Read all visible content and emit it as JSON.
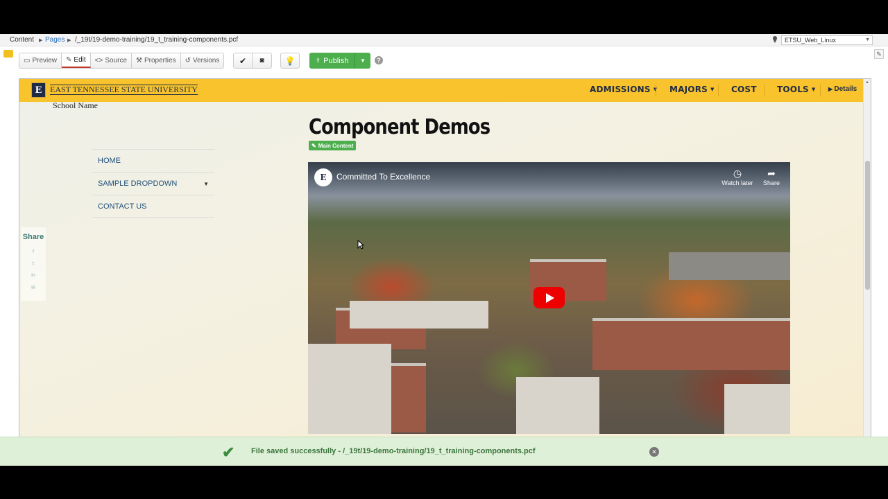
{
  "breadcrumb": {
    "root": "Content",
    "pages": "Pages",
    "path": "/_19t/19-demo-training/19_t_training-components.pcf"
  },
  "server": {
    "selected": "ETSU_Web_Linux"
  },
  "toolbar": {
    "preview": "Preview",
    "edit": "Edit",
    "source": "Source",
    "properties": "Properties",
    "versions": "Versions",
    "publish": "Publish",
    "help": "?"
  },
  "site": {
    "university": "EAST TENNESSEE STATE UNIVERSITY",
    "logo_letter": "E",
    "school_name": "School Name",
    "nav": [
      {
        "label": "ADMISSIONS",
        "dropdown": true
      },
      {
        "label": "MAJORS",
        "dropdown": true
      },
      {
        "label": "COST",
        "dropdown": false
      },
      {
        "label": "TOOLS",
        "dropdown": true
      }
    ],
    "details": "Details",
    "side_nav": [
      {
        "label": "HOME"
      },
      {
        "label": "SAMPLE DROPDOWN"
      },
      {
        "label": "CONTACT US"
      }
    ],
    "share_label": "Share",
    "share_icons": [
      "f",
      "t",
      "in",
      "✉"
    ],
    "page_title": "Component Demos",
    "main_content_tag": "Main Content"
  },
  "video": {
    "channel_letter": "E",
    "title": "Committed To Excellence",
    "watch_later": "Watch later",
    "share": "Share"
  },
  "status": {
    "message": "File saved successfully - /_19t/19-demo-training/19_t_training-components.pcf"
  }
}
